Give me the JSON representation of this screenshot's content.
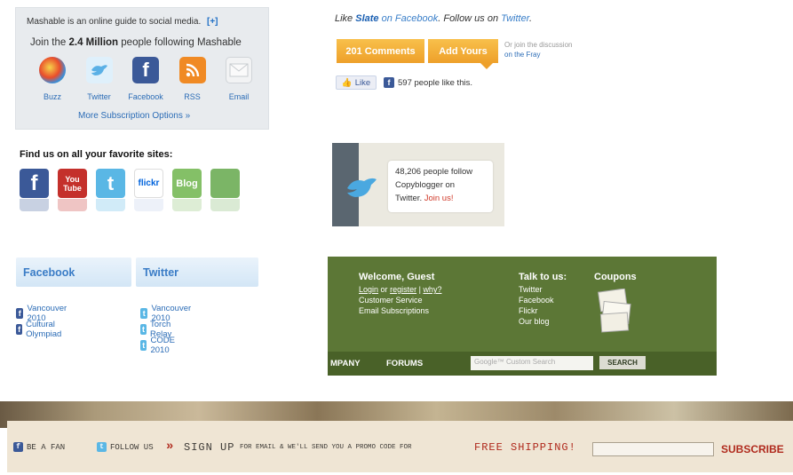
{
  "mashable": {
    "intro": "Mashable is an online guide to social media.",
    "plus": "[+]",
    "join_prefix": "Join the",
    "join_count": "2.4 Million",
    "join_suffix": "people following Mashable",
    "icons": [
      {
        "label": "Buzz",
        "icon": "google-buzz-icon",
        "color": "#f0b54a"
      },
      {
        "label": "Twitter",
        "icon": "twitter-bird-icon",
        "color": "#6fb6e8"
      },
      {
        "label": "Facebook",
        "icon": "facebook-icon",
        "color": "#3b5998"
      },
      {
        "label": "RSS",
        "icon": "rss-icon",
        "color": "#f08a24"
      },
      {
        "label": "Email",
        "icon": "email-envelope-icon",
        "color": "#dfe2e5"
      }
    ],
    "more": "More Subscription Options »"
  },
  "findus": {
    "title": "Find us on all your favorite sites:",
    "sites": [
      {
        "glyph": "f",
        "icon": "facebook-site-icon",
        "color": "#3b5998"
      },
      {
        "glyph": "You Tube",
        "icon": "youtube-site-icon",
        "color": "#c4302b"
      },
      {
        "glyph": "t",
        "icon": "twitter-site-icon",
        "color": "#5ab7e5"
      },
      {
        "glyph": "flickr",
        "icon": "flickr-site-icon",
        "color": "#ffffff"
      },
      {
        "glyph": "Blog",
        "icon": "blog-site-icon",
        "color": "#84c067"
      },
      {
        "glyph": "",
        "icon": "widget-site-icon",
        "color": "#7bb566"
      }
    ]
  },
  "fbtw": {
    "facebook_header": "Facebook",
    "twitter_header": "Twitter",
    "facebook_links": [
      "Vancouver 2010",
      "Cultural Olympiad"
    ],
    "twitter_links": [
      "Vancouver 2010",
      "Torch Relay",
      "CODE 2010"
    ]
  },
  "slate": {
    "like_text": "Like",
    "brand": "Slate",
    "on_facebook": "on Facebook",
    "follow_text": "Follow us on",
    "twitter": "Twitter",
    "comments_button": "201 Comments",
    "add_button": "Add Yours",
    "fray_text": "Or join the discussion",
    "fray_link": "on the Fray",
    "like_button": "Like",
    "like_count": "597 people like this."
  },
  "copyblogger": {
    "line1": "48,206 people follow",
    "line2": "Copyblogger on",
    "line3_prefix": "Twitter.",
    "join": "Join us!"
  },
  "green": {
    "welcome_title": "Welcome, Guest",
    "login": "Login",
    "or": "or",
    "register": "register",
    "why": "why?",
    "customer_service": "Customer Service",
    "email_subs": "Email Subscriptions",
    "talk_title": "Talk to us:",
    "talk_links": [
      "Twitter",
      "Facebook",
      "Flickr",
      "Our blog"
    ],
    "coupons_title": "Coupons",
    "nav_company": "MPANY",
    "nav_forums": "FORUMS",
    "search_placeholder": "Google™ Custom Search",
    "search_button": "SEARCH"
  },
  "banner": {
    "be_a_fan": "BE A FAN",
    "follow_us": "FOLLOW US",
    "arrows": "»",
    "sign_up": "SIGN UP",
    "for_email": "FOR EMAIL & WE'LL SEND YOU A PROMO CODE FOR",
    "free_shipping": "FREE SHIPPING!",
    "subscribe": "SUBSCRIBE",
    "email_value": ""
  }
}
